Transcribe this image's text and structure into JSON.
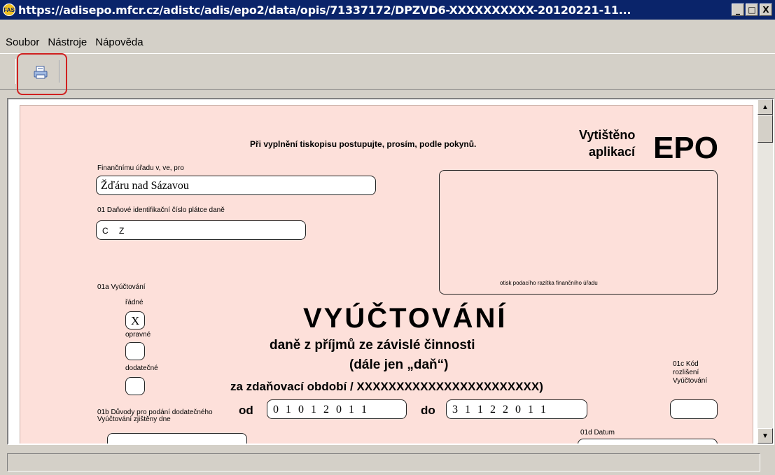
{
  "window": {
    "app_icon": "FAS",
    "title": "https://adisepo.mfcr.cz/adistc/adis/epo2/data/opis/71337172/DPZVD6-XXXXXXXXXX-20120221-11...",
    "min_label": "_",
    "max_label": "□",
    "close_label": "X"
  },
  "menu": {
    "soubor": "Soubor",
    "nastroje": "Nástroje",
    "napoveda": "Nápověda"
  },
  "toolbar": {
    "print_icon": "printer-icon"
  },
  "form": {
    "instruction": "Při vyplnění tiskopisu postupujte, prosím, podle pokynů.",
    "printed_by": "Vytištěno",
    "app": "aplikací",
    "epo": "EPO",
    "office_label": "Finančnímu úřadu v, ve, pro",
    "office_value": "Žďáru nad Sázavou",
    "dic_label": "01 Daňové identifikační číslo plátce daně",
    "dic_value": "C Z",
    "stamp_label": "otisk podacího razítka finančního úřadu",
    "vyuct_label": "01a Vyúčtování",
    "radne": "řádné",
    "radne_mark": "X",
    "opravne": "opravné",
    "dodatecne": "dodatečné",
    "main_title": "VYÚČTOVÁNÍ",
    "subtitle1": "daně z příjmů ze závislé činnosti",
    "subtitle2": "(dále jen „daň“)",
    "period_line": "za zdaňovací období / XXXXXXXXXXXXXXXXXXXXXXX)",
    "od": "od",
    "od_value": "0 1 0 1 2 0 1 1",
    "do": "do",
    "do_value": "3 1 1 2 2 0 1 1",
    "kod_label": "01c Kód rozlišení Vyúčtování",
    "duvody_label": "01b Důvody pro podání dodatečného Vyúčtování zjištěny dne",
    "datum_label": "01d Datum"
  }
}
